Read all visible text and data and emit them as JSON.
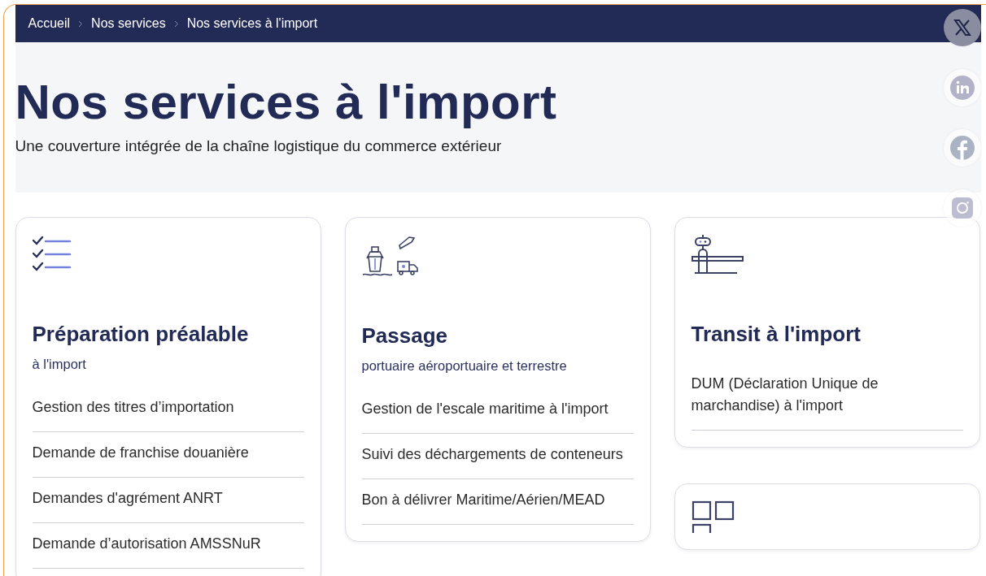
{
  "breadcrumb": [
    {
      "label": "Accueil"
    },
    {
      "label": "Nos services"
    },
    {
      "label": "Nos services à l'import"
    }
  ],
  "hero": {
    "title": "Nos services à l'import",
    "subtitle": "Une couverture intégrée de la chaîne logistique du commerce extérieur"
  },
  "social": [
    {
      "kind": "x"
    },
    {
      "kind": "linkedin"
    },
    {
      "kind": "facebook"
    },
    {
      "kind": "instagram"
    }
  ],
  "columns": [
    {
      "cards": [
        {
          "kind": "checklist",
          "title": "Préparation préalable",
          "subtitle": "à l'import",
          "items": [
            "Gestion des titres d’importation",
            "Demande de franchise douanière",
            "Demandes d'agrément ANRT",
            "Demande d’autorisation AMSSNuR"
          ]
        }
      ]
    },
    {
      "cards": [
        {
          "kind": "transport",
          "title": "Passage",
          "subtitle": "portuaire aéroportuaire et terrestre",
          "items": [
            "Gestion de l'escale maritime à l'import",
            "Suivi des déchargements de conteneurs",
            "Bon à délivrer Maritime/Aérien/MEAD"
          ]
        }
      ]
    },
    {
      "cards": [
        {
          "kind": "barrier",
          "title": "Transit à l'import",
          "items": [
            "DUM (Déclaration Unique de marchandise) à l'import"
          ]
        },
        {
          "kind": "grid"
        }
      ]
    }
  ]
}
